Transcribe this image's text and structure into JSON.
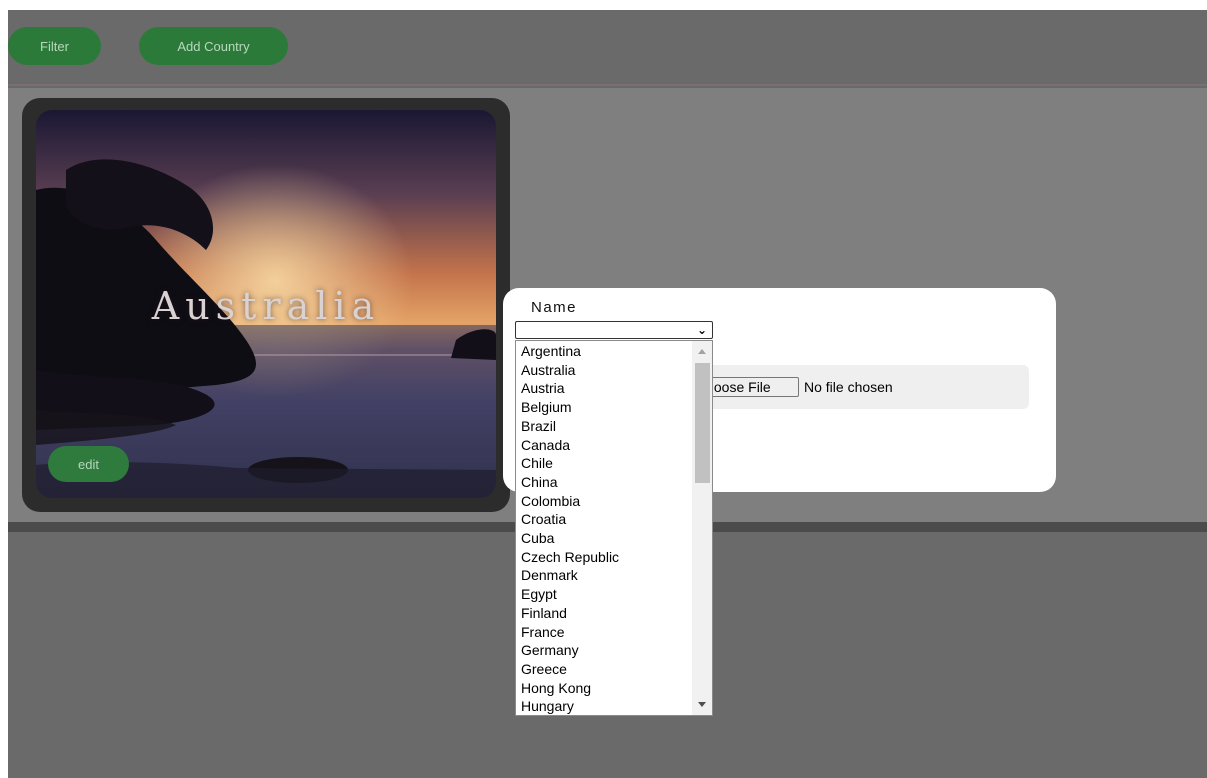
{
  "toolbar": {
    "filter_label": "Filter",
    "add_country_label": "Add Country"
  },
  "card": {
    "title": "Australia",
    "edit_label": "edit"
  },
  "modal": {
    "name_label": "Name",
    "selected_value": "",
    "file_button_label": "Choose File",
    "file_status": "No file chosen"
  },
  "dropdown": {
    "options": [
      "Argentina",
      "Australia",
      "Austria",
      "Belgium",
      "Brazil",
      "Canada",
      "Chile",
      "China",
      "Colombia",
      "Croatia",
      "Cuba",
      "Czech Republic",
      "Denmark",
      "Egypt",
      "Finland",
      "France",
      "Germany",
      "Greece",
      "Hong Kong",
      "Hungary"
    ]
  },
  "colors": {
    "button_green": "#2c7a3a",
    "page_background": "#6b6a6b",
    "content_band": "#7f7f7f"
  },
  "icons": {
    "select_arrow": "chevron-down-icon",
    "scroll_up": "scroll-up-arrow-icon",
    "scroll_down": "scroll-down-arrow-icon"
  }
}
